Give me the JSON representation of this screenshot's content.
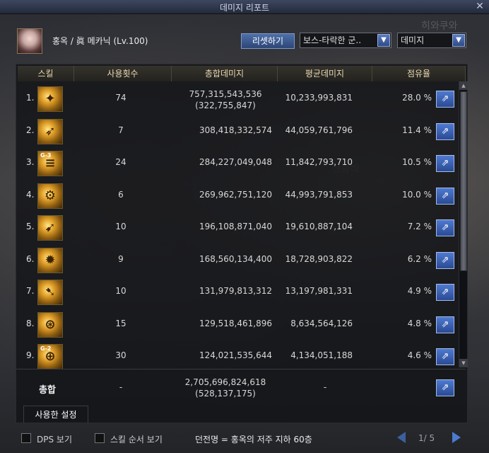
{
  "window": {
    "title": "데미지 리포트",
    "close_label": "✕"
  },
  "character": {
    "name": "홍옥 / 眞 메카닉 (Lv.100)"
  },
  "controls": {
    "reset_label": "리셋하기",
    "mode_value": "보스-타락한 군..",
    "type_value": "데미지"
  },
  "table": {
    "headers": [
      "스킬",
      "사용횟수",
      "총합데미지",
      "평균데미지",
      "점유율"
    ],
    "rows": [
      {
        "rank": "1.",
        "uses": "74",
        "total": "757,315,543,536",
        "total_sub": "(322,755,847)",
        "avg": "10,233,993,831",
        "share": "28.0 %"
      },
      {
        "rank": "2.",
        "uses": "7",
        "total": "308,418,332,574",
        "total_sub": "",
        "avg": "44,059,761,796",
        "share": "11.4 %"
      },
      {
        "rank": "3.",
        "uses": "24",
        "total": "284,227,049,048",
        "total_sub": "",
        "avg": "11,842,793,710",
        "share": "10.5 %",
        "tag": "G-3"
      },
      {
        "rank": "4.",
        "uses": "6",
        "total": "269,962,751,120",
        "total_sub": "",
        "avg": "44,993,791,853",
        "share": "10.0 %"
      },
      {
        "rank": "5.",
        "uses": "10",
        "total": "196,108,871,040",
        "total_sub": "",
        "avg": "19,610,887,104",
        "share": "7.2 %"
      },
      {
        "rank": "6.",
        "uses": "9",
        "total": "168,560,134,400",
        "total_sub": "",
        "avg": "18,728,903,822",
        "share": "6.2 %"
      },
      {
        "rank": "7.",
        "uses": "10",
        "total": "131,979,813,312",
        "total_sub": "",
        "avg": "13,197,981,331",
        "share": "4.9 %"
      },
      {
        "rank": "8.",
        "uses": "15",
        "total": "129,518,461,896",
        "total_sub": "",
        "avg": "8,634,564,126",
        "share": "4.8 %"
      },
      {
        "rank": "9.",
        "uses": "30",
        "total": "124,021,535,644",
        "total_sub": "",
        "avg": "4,134,051,188",
        "share": "4.6 %",
        "tag": "G-2"
      }
    ],
    "summary": {
      "label": "총합",
      "uses": "-",
      "total": "2,705,696,824,618",
      "total_sub": "(528,137,175)",
      "avg": "-"
    }
  },
  "settings_tab_label": "사용한 설정",
  "footer": {
    "dps_label": "DPS 보기",
    "skill_order_label": "스킬 순서 보기",
    "dungeon": "던전명 = 홍옥의 저주 지하 60층",
    "page": "1/ 5"
  },
  "colors": {
    "header_text": "#e9d9b2",
    "accent_blue": "#4f7ad0"
  }
}
